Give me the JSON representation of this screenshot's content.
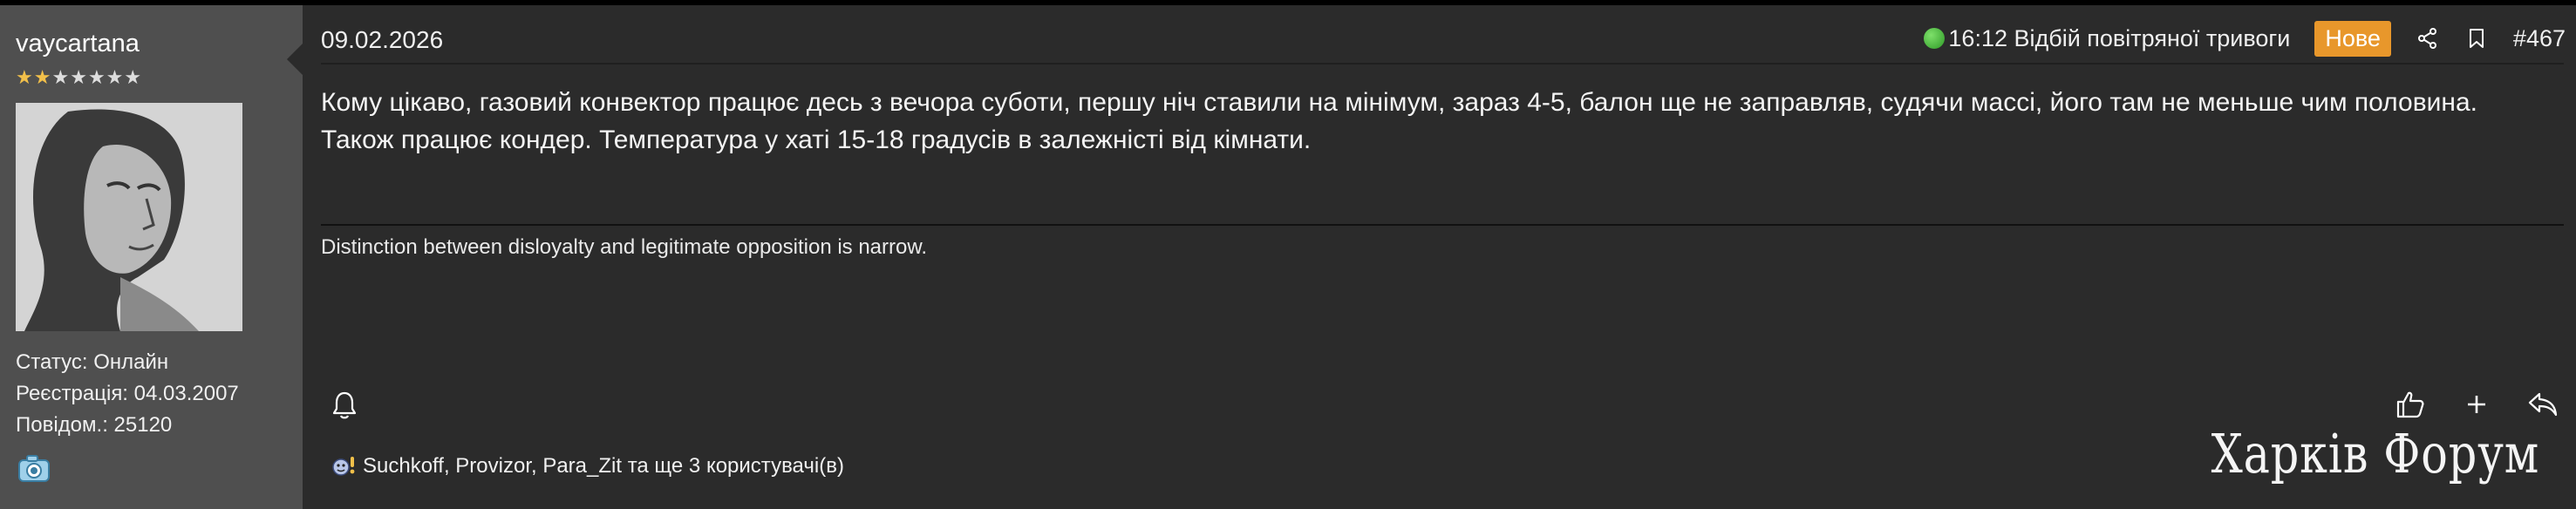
{
  "user": {
    "name": "vaycartana",
    "rating": {
      "filled": 2,
      "total": 7
    },
    "status": "Статус: Онлайн",
    "registration": "Реєстрація: 04.03.2007",
    "posts": "Повідом.: 25120",
    "avatar_icon": "portrait-avatar",
    "extra_icon": "camera-badge-icon"
  },
  "post": {
    "date": "09.02.2026",
    "alert_text": "16:12 Відбій повітряної тривоги",
    "badge": "Нове",
    "number": "#467",
    "body_line1": "Кому цікаво, газовий конвектор працює десь з вечора суботи, першу ніч ставили на мінімум, зараз 4-5, балон ще не заправляв, судячи массі, його там не меньше чим половина.",
    "body_line2": "Також працює кондер. Температура у хаті 15-18 градусів в залежністі від кімнати.",
    "signature": "Distinction between disloyalty and legitimate opposition is narrow.",
    "reactions": "Suchkoff, Provizor, Para_Zit та ще 3 користувачі(в)"
  },
  "forum_logo": "Харків Форум",
  "icons": {
    "share": "share-icon",
    "bookmark": "bookmark-icon",
    "bell": "bell-icon",
    "like": "thumbs-up-icon",
    "add": "plus-icon",
    "reply": "reply-icon"
  },
  "colors": {
    "background": "#2b2b2b",
    "sidebar": "#4f4f4f",
    "badge": "#e8972b",
    "star": "#f2c04a"
  }
}
